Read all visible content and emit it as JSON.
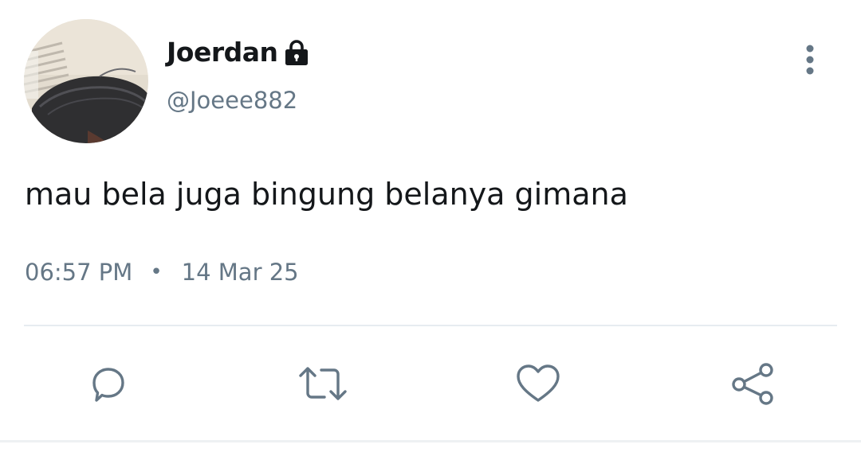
{
  "user": {
    "display_name": "Joerdan",
    "handle": "@Joeee882",
    "protected_icon": "lock-icon"
  },
  "tweet": {
    "text": "mau bela juga bingung belanya gimana",
    "time": "06:57 PM",
    "separator": "•",
    "date": "14 Mar 25"
  },
  "actions": {
    "reply_icon": "reply-icon",
    "retweet_icon": "retweet-icon",
    "like_icon": "heart-icon",
    "share_icon": "share-icon",
    "more_icon": "more-vertical-icon"
  },
  "colors": {
    "text": "#14171a",
    "secondary": "#657786",
    "icon": "#657786",
    "divider": "#e6ecf0"
  }
}
